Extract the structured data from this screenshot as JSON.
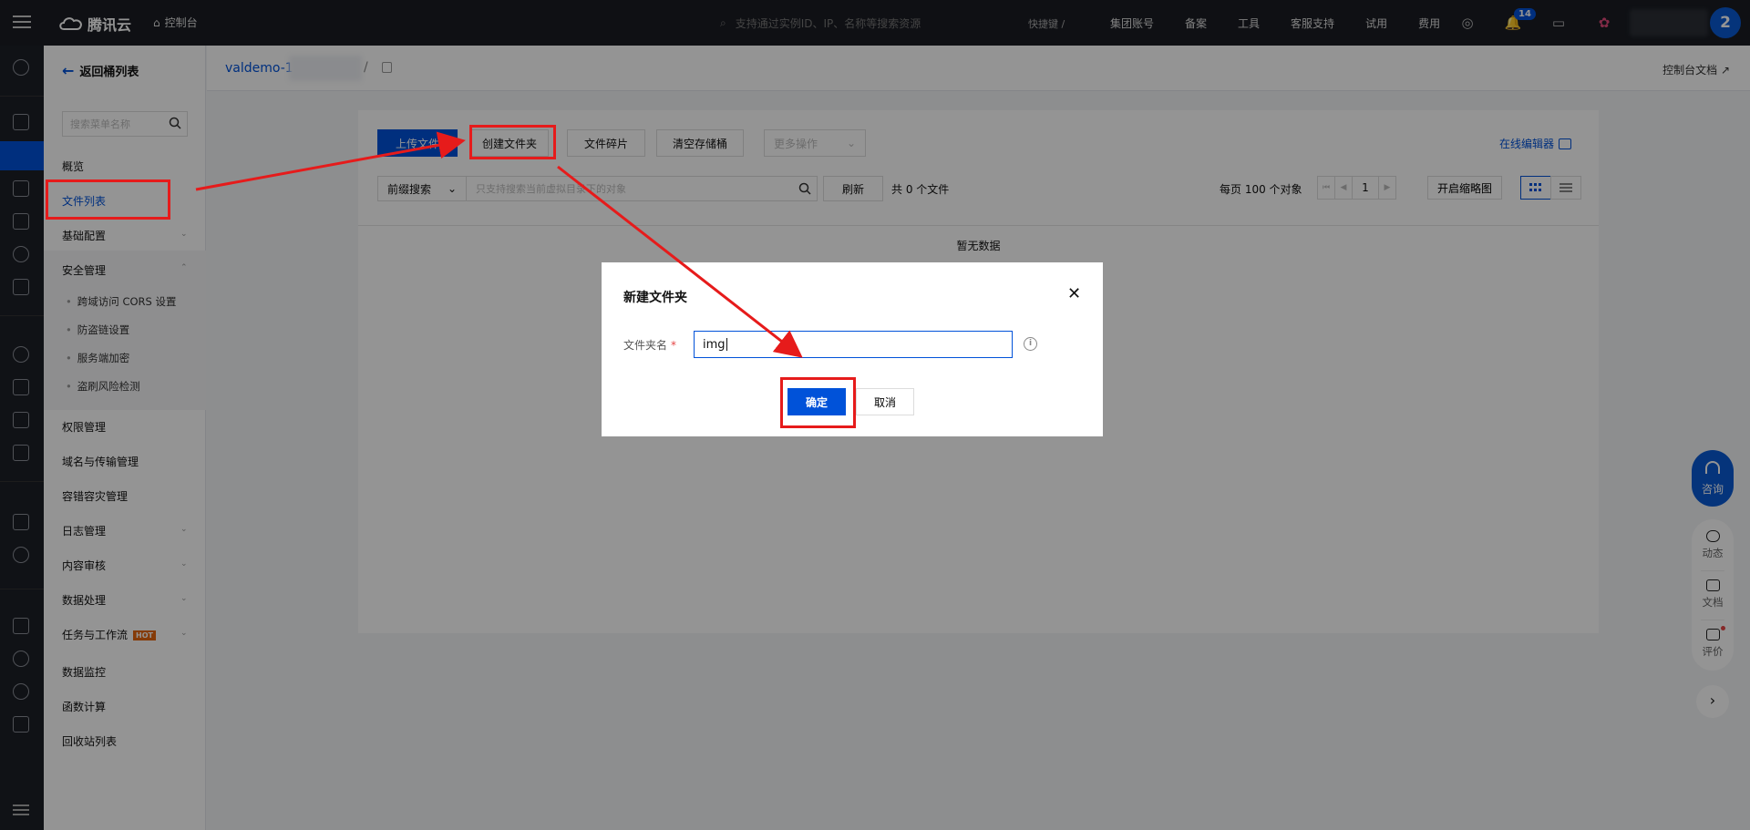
{
  "topbar": {
    "brand": "腾讯云",
    "console": "控制台",
    "search_placeholder": "支持通过实例ID、IP、名称等搜索资源",
    "shortcut": "快捷键 /",
    "nav": [
      "集团账号",
      "备案",
      "工具",
      "客服支持",
      "试用",
      "费用"
    ],
    "notification_count": "14",
    "avatar_label": "2"
  },
  "sidebar": {
    "back_label": "返回桶列表",
    "search_placeholder": "搜索菜单名称",
    "items": [
      {
        "label": "概览"
      },
      {
        "label": "文件列表"
      },
      {
        "label": "基础配置"
      },
      {
        "label": "安全管理"
      },
      {
        "label": "权限管理"
      },
      {
        "label": "域名与传输管理"
      },
      {
        "label": "容错容灾管理"
      },
      {
        "label": "日志管理"
      },
      {
        "label": "内容审核"
      },
      {
        "label": "数据处理"
      },
      {
        "label": "任务与工作流",
        "badge": "HOT"
      },
      {
        "label": "数据监控"
      },
      {
        "label": "函数计算"
      },
      {
        "label": "回收站列表"
      }
    ],
    "security_sub": [
      "跨域访问 CORS 设置",
      "防盗链设置",
      "服务端加密",
      "盗刷风险检测"
    ]
  },
  "breadcrumb": {
    "bucket": "valdemo-1",
    "separator": "/",
    "doc_link": "控制台文档"
  },
  "toolbar": {
    "upload": "上传文件",
    "create_folder": "创建文件夹",
    "fragments": "文件碎片",
    "clear_bucket": "清空存储桶",
    "more_ops": "更多操作",
    "online_editor": "在线编辑器"
  },
  "filter": {
    "mode": "前缀搜索",
    "placeholder": "只支持搜索当前虚拟目录下的对象",
    "refresh": "刷新",
    "count": "共 0 个文件",
    "per_page": "每页 100 个对象",
    "page": "1",
    "thumbnail": "开启缩略图"
  },
  "table": {
    "empty": "暂无数据"
  },
  "modal": {
    "title": "新建文件夹",
    "field_label": "文件夹名",
    "required_mark": "*",
    "value": "img",
    "ok": "确定",
    "cancel": "取消"
  },
  "widgets": {
    "consult": "咨询",
    "news": "动态",
    "docs": "文档",
    "feedback": "评价"
  },
  "colors": {
    "brand_blue": "#0052d9",
    "annotation_red": "#e61b1b",
    "topbar_bg": "#1a1d24"
  }
}
